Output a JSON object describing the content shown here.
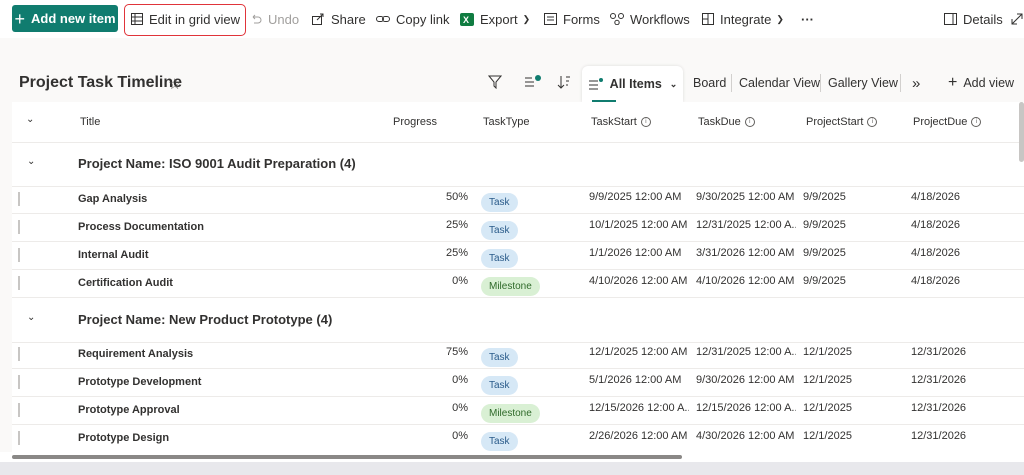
{
  "toolbar": {
    "add_new_item": "Add new item",
    "edit_grid": "Edit in grid view",
    "undo": "Undo",
    "share": "Share",
    "copy_link": "Copy link",
    "export": "Export",
    "forms": "Forms",
    "workflows": "Workflows",
    "integrate": "Integrate",
    "more": "···",
    "details": "Details"
  },
  "page": {
    "title": "Project Task Timeline"
  },
  "views": {
    "all_items": "All Items",
    "board": "Board",
    "calendar": "Calendar View",
    "gallery": "Gallery View",
    "more": "»",
    "add_view": "Add view"
  },
  "columns": {
    "title": "Title",
    "progress": "Progress",
    "tasktype": "TaskType",
    "taskstart": "TaskStart",
    "taskdue": "TaskDue",
    "projectstart": "ProjectStart",
    "projectdue": "ProjectDue"
  },
  "groups": [
    {
      "label": "Project Name: ISO 9001 Audit Preparation (4)",
      "rows": [
        {
          "title": "Gap Analysis",
          "progress": "50%",
          "type": "Task",
          "task_start": "9/9/2025 12:00 AM",
          "task_due": "9/30/2025 12:00 AM",
          "project_start": "9/9/2025",
          "project_due": "4/18/2026"
        },
        {
          "title": "Process Documentation",
          "progress": "25%",
          "type": "Task",
          "task_start": "10/1/2025 12:00 AM",
          "task_due": "12/31/2025 12:00 A...",
          "project_start": "9/9/2025",
          "project_due": "4/18/2026"
        },
        {
          "title": "Internal Audit",
          "progress": "25%",
          "type": "Task",
          "task_start": "1/1/2026 12:00 AM",
          "task_due": "3/31/2026 12:00 AM",
          "project_start": "9/9/2025",
          "project_due": "4/18/2026"
        },
        {
          "title": "Certification Audit",
          "progress": "0%",
          "type": "Milestone",
          "task_start": "4/10/2026 12:00 AM",
          "task_due": "4/10/2026 12:00 AM",
          "project_start": "9/9/2025",
          "project_due": "4/18/2026"
        }
      ]
    },
    {
      "label": "Project Name: New Product Prototype (4)",
      "rows": [
        {
          "title": "Requirement Analysis",
          "progress": "75%",
          "type": "Task",
          "task_start": "12/1/2025 12:00 AM",
          "task_due": "12/31/2025 12:00 A...",
          "project_start": "12/1/2025",
          "project_due": "12/31/2026"
        },
        {
          "title": "Prototype Development",
          "progress": "0%",
          "type": "Task",
          "task_start": "5/1/2026 12:00 AM",
          "task_due": "9/30/2026 12:00 AM",
          "project_start": "12/1/2025",
          "project_due": "12/31/2026"
        },
        {
          "title": "Prototype Approval",
          "progress": "0%",
          "type": "Milestone",
          "task_start": "12/15/2026 12:00 A...",
          "task_due": "12/15/2026 12:00 A...",
          "project_start": "12/1/2025",
          "project_due": "12/31/2026"
        },
        {
          "title": "Prototype Design",
          "progress": "0%",
          "type": "Task",
          "task_start": "2/26/2026 12:00 AM",
          "task_due": "4/30/2026 12:00 AM",
          "project_start": "12/1/2025",
          "project_due": "12/31/2026"
        }
      ]
    }
  ],
  "colors": {
    "accent": "#107c6f",
    "highlight": "#e0343a",
    "task_chip": "#d6e8f6",
    "milestone_chip": "#d9f0d4"
  }
}
